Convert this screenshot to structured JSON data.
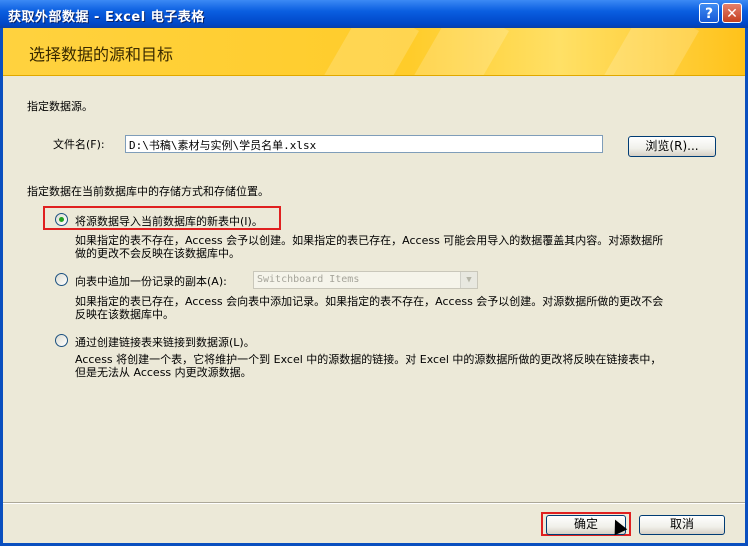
{
  "window": {
    "title": "获取外部数据 - Excel 电子表格",
    "help_glyph": "?",
    "close_glyph": "✕"
  },
  "banner": {
    "heading": "选择数据的源和目标"
  },
  "source": {
    "label": "指定数据源。",
    "file_label": "文件名(F):",
    "file_value": "D:\\书稿\\素材与实例\\学员名单.xlsx",
    "browse_label": "浏览(R)..."
  },
  "storage": {
    "label": "指定数据在当前数据库中的存储方式和存储位置。",
    "options": [
      {
        "label": "将源数据导入当前数据库的新表中(I)。",
        "selected": true,
        "desc1": "如果指定的表不存在，Access 会予以创建。如果指定的表已存在，Access 可能会用导入的数据覆盖其内容。对源数据所",
        "desc2": "做的更改不会反映在该数据库中。"
      },
      {
        "label": "向表中追加一份记录的副本(A):",
        "selected": false,
        "select_value": "Switchboard Items",
        "desc1": "如果指定的表已存在，Access 会向表中添加记录。如果指定的表不存在，Access 会予以创建。对源数据所做的更改不会",
        "desc2": "反映在该数据库中。"
      },
      {
        "label": "通过创建链接表来链接到数据源(L)。",
        "selected": false,
        "desc1": "Access 将创建一个表，它将维护一个到 Excel 中的源数据的链接。对 Excel 中的源数据所做的更改将反映在链接表中，",
        "desc2": "但是无法从 Access 内更改源数据。"
      }
    ]
  },
  "footer": {
    "ok_label": "确定",
    "cancel_label": "取消"
  },
  "colors": {
    "highlight": "#e02020",
    "title_bar": "#0a5ee0",
    "banner": "#ffd23f"
  }
}
